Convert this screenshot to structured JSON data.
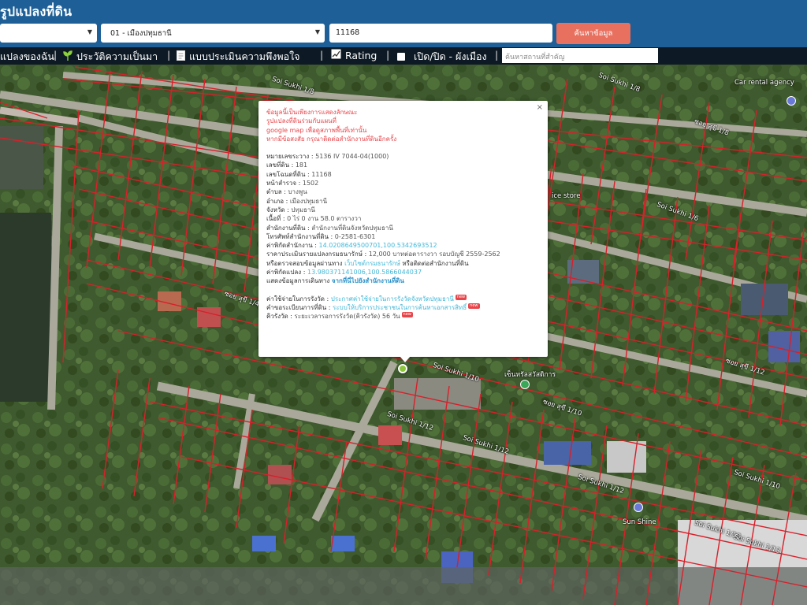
{
  "header": {
    "app_title": "รูปแปลงที่ดิน",
    "province_select": "",
    "district_select": "01 - เมืองปทุมธานี",
    "parcel_input": "11168",
    "search_button": "ค้นหาข้อมูล"
  },
  "nav": {
    "items": [
      {
        "label": "แปลงของฉัน"
      },
      {
        "label": "ประวัติความเป็นมา"
      },
      {
        "label": "แบบประเมินความพึงพอใจ"
      },
      {
        "label": "Rating"
      },
      {
        "label": "เปิด/ปิด - ผังเมือง"
      }
    ],
    "place_search_placeholder": "ค้นหาสถานที่สำคัญ"
  },
  "popup": {
    "disclaimer": [
      "ข้อมูลนี้เป็นเพียงการแสดงลักษณะ",
      "รูปแปลงที่ดินร่วมกับแผนที่",
      "google map เพื่อดูสภาพพื้นที่เท่านั้น",
      "หากมีข้อสงสัย กรุณาติดต่อสำนักงานที่ดินอีกครั้ง"
    ],
    "fields": [
      {
        "label": "หมายเลขระวาง",
        "value": "5136 IV 7044-04(1000)"
      },
      {
        "label": "เลขที่ดิน",
        "value": "181"
      },
      {
        "label": "เลขโฉนดที่ดิน",
        "value": "11168"
      },
      {
        "label": "หน้าสำรวจ",
        "value": "1502"
      },
      {
        "label": "ตำบล",
        "value": "บางพูน"
      },
      {
        "label": "อำเภอ",
        "value": "เมืองปทุมธานี"
      },
      {
        "label": "จังหวัด",
        "value": "ปทุมธานี"
      },
      {
        "label": "เนื้อที่",
        "value": "0 ไร่ 0 งาน 58.0 ตารางวา"
      },
      {
        "label": "สำนักงานที่ดิน",
        "value": "สำนักงานที่ดินจังหวัดปทุมธานี"
      },
      {
        "label": "โทรศัพท์สำนักงานที่ดิน",
        "value": "0-2581-6301"
      }
    ],
    "office_coords_label": "ค่าพิกัดสำนักงาน",
    "office_coords_value": "14.0208649500701,100.5342693512",
    "price_label": "ราคาประเมินรายแปลงกรมธนารักษ์",
    "price_value": "12,000 บาทต่อตารางวา รอบบัญชี 2559-2562",
    "check_text": "หรือตรวจสอบข้อมูลผ่านทาง",
    "check_link": "เว็บไซต์กรมธนารักษ์",
    "check_suffix": "หรือติดต่อสำนักงานที่ดิน",
    "parcel_coords_label": "ค่าพิกัดแปลง",
    "parcel_coords_value": "13.980371141006,100.5866044037",
    "route_label": "แสดงข้อมูลการเดินทาง",
    "route_link": "จากที่นี่ไปยังสำนักงานที่ดิน",
    "fee_label": "ค่าใช้จ่ายในการรังวัด",
    "fee_link": "ประกาศค่าใช้จ่ายในการรังวัดจังหวัดปทุมธานี",
    "fee_badge": "new",
    "queue_label": "คำขอระเบียนการที่ดิน",
    "queue_link": "ระบบให้บริการประชาชนในการค้นหาเอกสารสิทธิ์",
    "queue_badge": "new",
    "survey_label": "คิวรังวัด",
    "survey_value": "ระยะเวลารอการรังวัด(คิวรังวัด) 56 วัน",
    "survey_badge": "new",
    "close_glyph": "×"
  },
  "map": {
    "road_labels": [
      "Soi Sukhi 1/8",
      "Soi Sukhi 1/8",
      "ซอย สุขี 1/8",
      "Soi Sukhi 1/6",
      "Soi Sukhi 1/10",
      "ซอย สุขี 1/10",
      "Soi Sukhi 1/12",
      "Soi Sukhi 1/12",
      "Soi Sukhi 1/12",
      "Soi Sukhi 1/10",
      "Soi Sukhi 1/13",
      "ซอย สุขี 1/12",
      "Soi Sukhi 1/13",
      "ซอย สุขี 1/4"
    ],
    "poi_labels": [
      "Car rental agency",
      "เซ็นทรัลสวัสดิการ",
      "Sun Shine",
      "ice store"
    ]
  },
  "colors": {
    "header_bg": "#1d5f96",
    "nav_bg": "#0d1a25",
    "search_button": "#e8705f",
    "parcel_lines": "#d8202a",
    "disclaimer_text": "#e8454a",
    "link_text": "#44b8d8"
  }
}
